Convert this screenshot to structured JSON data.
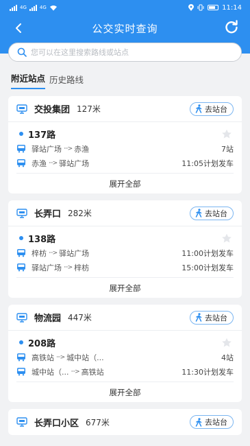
{
  "status_bar": {
    "network_left": "4G",
    "network_right": "4G",
    "time": "11:14"
  },
  "header": {
    "title": "公交实时查询"
  },
  "search": {
    "placeholder": "您可以在这里搜索路线或站点"
  },
  "tabs": [
    {
      "label": "附近站点",
      "active": true
    },
    {
      "label": "历史路线",
      "active": false
    }
  ],
  "go_label": "去站台",
  "expand_label": "展开全部",
  "stations": [
    {
      "name": "交投集团",
      "distance": "127米",
      "route": {
        "name": "137路",
        "directions": [
          {
            "from": "驿站广场",
            "to": "赤渔",
            "status": "7站"
          },
          {
            "from": "赤渔",
            "to": "驿站广场",
            "status": "11:05计划发车"
          }
        ]
      }
    },
    {
      "name": "长弄口",
      "distance": "282米",
      "route": {
        "name": "138路",
        "directions": [
          {
            "from": "梓枋",
            "to": "驿站广场",
            "status": "11:00计划发车"
          },
          {
            "from": "驿站广场",
            "to": "梓枋",
            "status": "15:00计划发车"
          }
        ]
      }
    },
    {
      "name": "物流园",
      "distance": "447米",
      "route": {
        "name": "208路",
        "directions": [
          {
            "from": "高铁站",
            "to": "城中站（...",
            "status": "4站"
          },
          {
            "from": "城中站（...",
            "to": "高铁站",
            "status": "11:30计划发车"
          }
        ]
      }
    },
    {
      "name": "长弄口小区",
      "distance": "677米"
    }
  ],
  "colors": {
    "primary": "#2d8ff0",
    "background": "#f1f2f4"
  },
  "icons": {
    "back": "chevron-left-icon",
    "refresh": "refresh-icon",
    "search": "search-icon",
    "station": "bus-stop-icon",
    "walk": "walk-icon",
    "bus": "bus-icon",
    "favorite": "star-icon"
  }
}
